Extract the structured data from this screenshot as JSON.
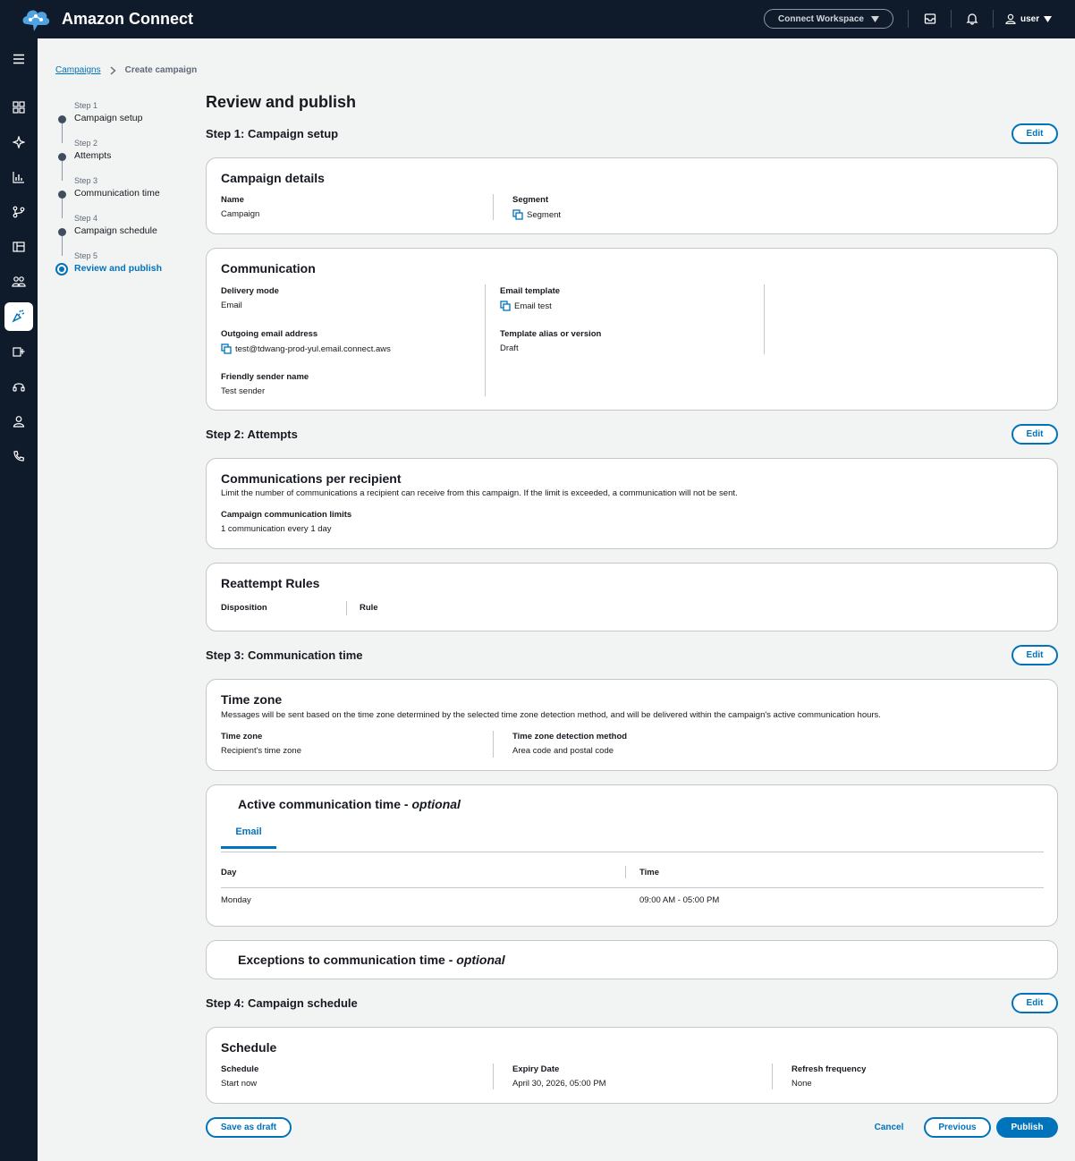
{
  "app": {
    "title": "Amazon Connect",
    "workspace_label": "Connect Workspace",
    "user_label": "user"
  },
  "breadcrumb": {
    "parent": "Campaigns",
    "current": "Create campaign"
  },
  "steps": [
    {
      "num": "Step 1",
      "label": "Campaign setup"
    },
    {
      "num": "Step 2",
      "label": "Attempts"
    },
    {
      "num": "Step 3",
      "label": "Communication time"
    },
    {
      "num": "Step 4",
      "label": "Campaign schedule"
    },
    {
      "num": "Step 5",
      "label": "Review and publish"
    }
  ],
  "page": {
    "title": "Review and publish",
    "edit_label": "Edit"
  },
  "step1": {
    "title": "Step 1: Campaign setup",
    "details": {
      "title": "Campaign details",
      "name_key": "Name",
      "name_val": "Campaign",
      "segment_key": "Segment",
      "segment_val": "Segment"
    },
    "communication": {
      "title": "Communication",
      "delivery_key": "Delivery mode",
      "delivery_val": "Email",
      "outgoing_key": "Outgoing email address",
      "outgoing_val": "test@tdwang-prod-yul.email.connect.aws",
      "sender_key": "Friendly sender name",
      "sender_val": "Test sender",
      "template_key": "Email template",
      "template_val": "Email test",
      "alias_key": "Template alias or version",
      "alias_val": "Draft"
    }
  },
  "step2": {
    "title": "Step 2: Attempts",
    "per_recipient": {
      "title": "Communications per recipient",
      "desc": "Limit the number of communications a recipient can receive from this campaign. If the limit is exceeded, a communication will not be sent.",
      "limits_key": "Campaign communication limits",
      "limits_val": "1 communication every 1 day"
    },
    "reattempt": {
      "title": "Reattempt Rules",
      "col1": "Disposition",
      "col2": "Rule"
    }
  },
  "step3": {
    "title": "Step 3: Communication time",
    "timezone": {
      "title": "Time zone",
      "desc": "Messages will be sent based on the time zone determined by the selected time zone detection method, and will be delivered within the campaign's active communication hours.",
      "tz_key": "Time zone",
      "tz_val": "Recipient's time zone",
      "method_key": "Time zone detection method",
      "method_val": "Area code and postal code"
    },
    "active": {
      "title": "Active communication time - ",
      "optional": "optional",
      "tab": "Email",
      "col_day": "Day",
      "col_time": "Time",
      "rows": [
        {
          "day": "Monday",
          "time": "09:00 AM - 05:00 PM"
        }
      ]
    },
    "exceptions": {
      "title": "Exceptions to communication time - ",
      "optional": "optional"
    }
  },
  "step4": {
    "title": "Step 4: Campaign schedule",
    "schedule": {
      "title": "Schedule",
      "schedule_key": "Schedule",
      "schedule_val": "Start now",
      "expiry_key": "Expiry Date",
      "expiry_val": "April 30, 2026, 05:00 PM",
      "refresh_key": "Refresh frequency",
      "refresh_val": "None"
    }
  },
  "footer": {
    "save_draft": "Save as draft",
    "cancel": "Cancel",
    "previous": "Previous",
    "publish": "Publish"
  },
  "colors": {
    "nav_bg": "#0f1b2a",
    "accent": "#0073bb",
    "page_bg": "#f2f3f3"
  },
  "icons": {
    "nav": [
      "menu-icon",
      "dashboard-icon",
      "sparkle-icon",
      "analytics-icon",
      "routing-icon",
      "channels-icon",
      "users-group-icon",
      "campaigns-icon",
      "agent-app-icon",
      "headset-icon",
      "user-icon",
      "phone-icon"
    ]
  }
}
